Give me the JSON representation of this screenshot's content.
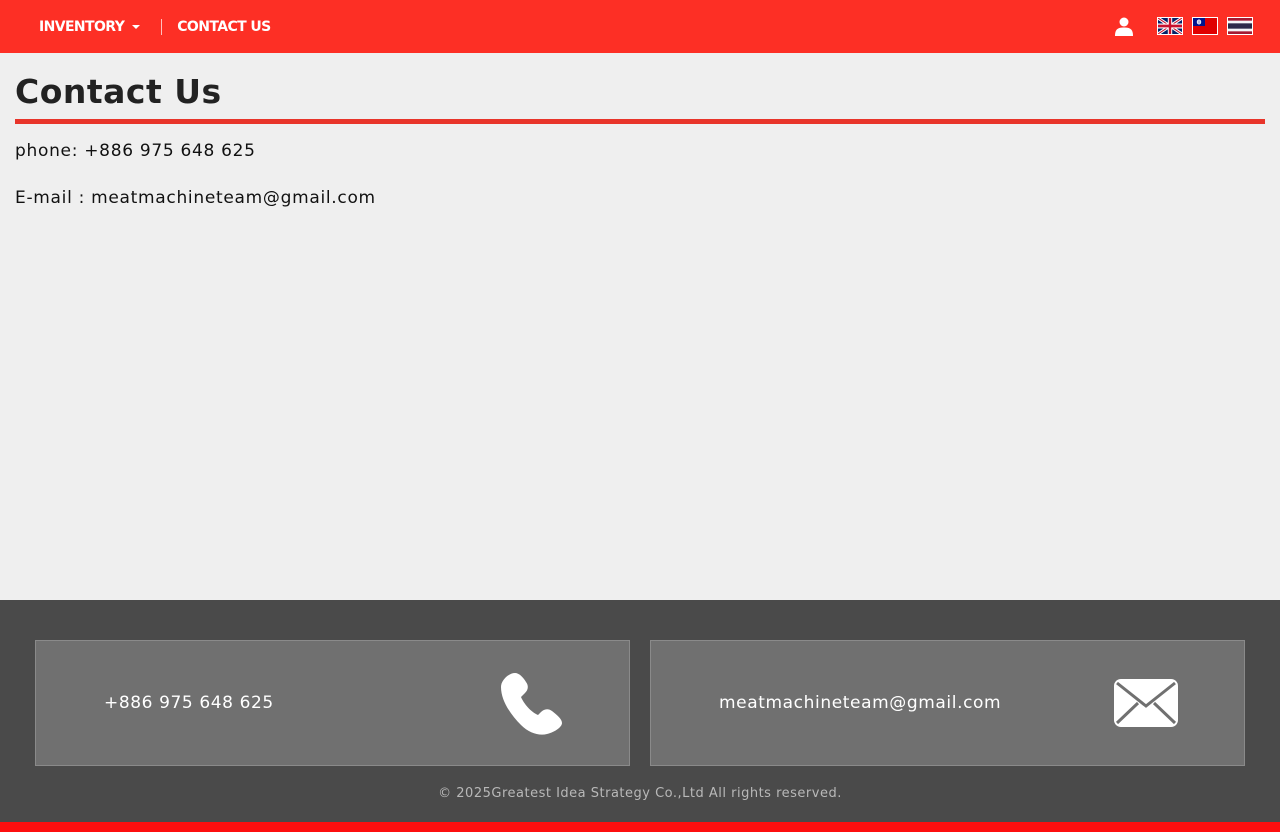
{
  "nav": {
    "inventory_label": "INVENTORY",
    "contact_label": "CONTACT US"
  },
  "header_icons": {
    "user": "user-icon",
    "flags": [
      "uk-flag-icon",
      "taiwan-flag-icon",
      "thailand-flag-icon"
    ]
  },
  "page": {
    "title": "Contact Us",
    "phone_line": "phone: +886 975 648 625",
    "email_line": "E-mail : meatmachineteam@gmail.com"
  },
  "footer": {
    "phone": "+886 975 648 625",
    "email": "meatmachineteam@gmail.com",
    "phone_icon": "phone-icon",
    "email_icon": "envelope-icon",
    "copyright": "© 2025Greatest Idea Strategy Co.,Ltd All rights reserved."
  },
  "colors": {
    "header_bg": "#fd2f25",
    "title_rule": "#e8342a",
    "footer_bg": "#4a4a4a",
    "card_bg": "#707070",
    "bottom_bar": "#fd0f0f"
  }
}
